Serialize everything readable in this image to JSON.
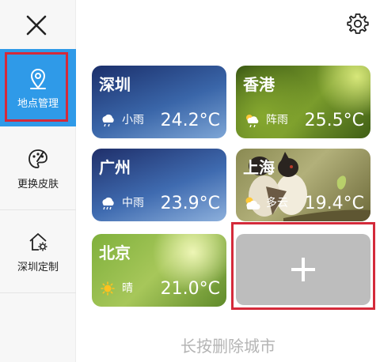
{
  "sidebar": {
    "items": [
      {
        "label": "地点管理",
        "icon": "location-pin-icon",
        "active": true
      },
      {
        "label": "更换皮肤",
        "icon": "palette-icon",
        "active": false
      },
      {
        "label": "深圳定制",
        "icon": "home-gear-icon",
        "active": false
      }
    ]
  },
  "cities": [
    {
      "name": "深圳",
      "condition": "小雨",
      "temp": "24.2°C",
      "icon": "light-rain-icon"
    },
    {
      "name": "香港",
      "condition": "阵雨",
      "temp": "25.5°C",
      "icon": "shower-icon"
    },
    {
      "name": "广州",
      "condition": "中雨",
      "temp": "23.9°C",
      "icon": "moderate-rain-icon"
    },
    {
      "name": "上海",
      "condition": "多云",
      "temp": "19.4°C",
      "icon": "partly-cloudy-icon"
    },
    {
      "name": "北京",
      "condition": "晴",
      "temp": "21.0°C",
      "icon": "sunny-icon"
    }
  ],
  "footer": {
    "hint": "长按删除城市"
  },
  "colors": {
    "accent": "#2f9ae8",
    "highlight": "#d42a3a"
  }
}
